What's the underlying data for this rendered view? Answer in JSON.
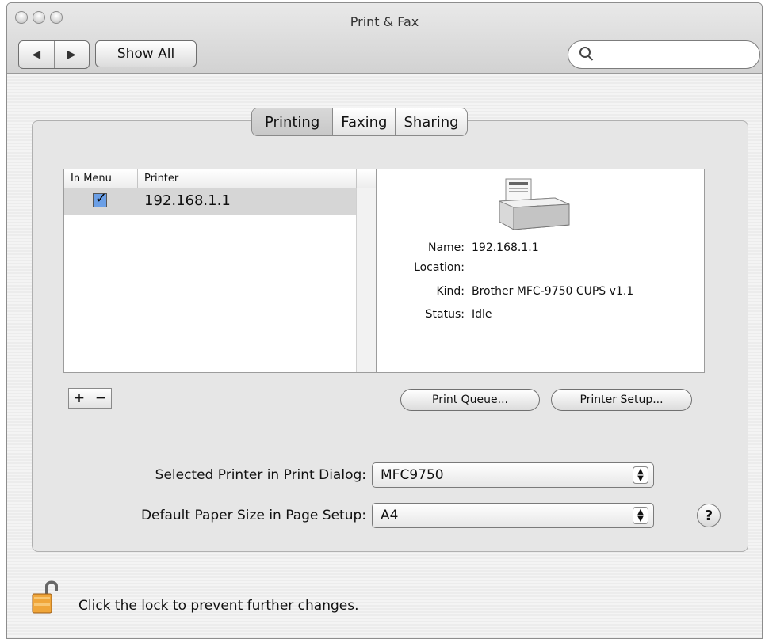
{
  "window": {
    "title": "Print & Fax"
  },
  "toolbar": {
    "back_icon": "◀",
    "forward_icon": "▶",
    "show_all_label": "Show All",
    "search_value": ""
  },
  "tabs": [
    {
      "label": "Printing",
      "active": true
    },
    {
      "label": "Faxing",
      "active": false
    },
    {
      "label": "Sharing",
      "active": false
    }
  ],
  "printer_list": {
    "headers": {
      "in_menu": "In Menu",
      "printer": "Printer"
    },
    "rows": [
      {
        "in_menu": true,
        "name": "192.168.1.1"
      }
    ]
  },
  "printer_info": {
    "name_label": "Name:",
    "name_value": "192.168.1.1",
    "location_label": "Location:",
    "location_value": "",
    "kind_label": "Kind:",
    "kind_value": "Brother MFC-9750 CUPS v1.1",
    "status_label": "Status:",
    "status_value": "Idle"
  },
  "buttons": {
    "add": "+",
    "remove": "−",
    "print_queue": "Print Queue...",
    "printer_setup": "Printer Setup..."
  },
  "settings": {
    "selected_printer_label": "Selected Printer in Print Dialog:",
    "selected_printer_value": "MFC9750",
    "paper_size_label": "Default Paper Size in Page Setup:",
    "paper_size_value": "A4",
    "help": "?"
  },
  "footer": {
    "lock_text": "Click the lock to prevent further changes."
  },
  "icons": {
    "printer": "printer-icon",
    "lock": "lock-icon",
    "search": "search-icon"
  }
}
